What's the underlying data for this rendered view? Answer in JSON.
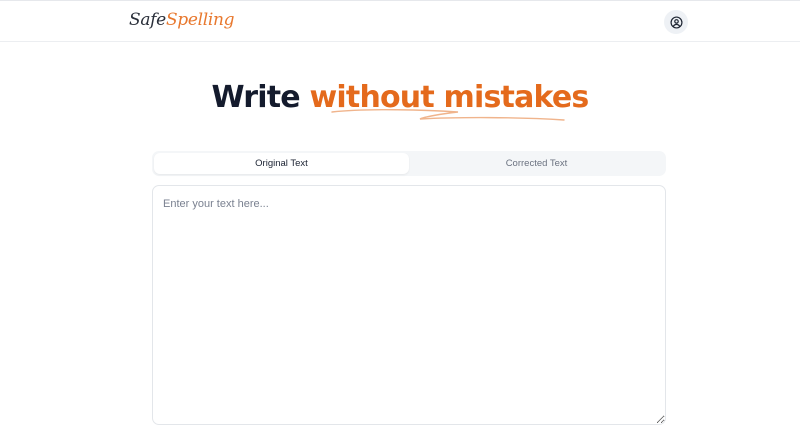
{
  "header": {
    "logo_part1": "Safe",
    "logo_part2": "Spelling",
    "account_icon": "user-circle-icon"
  },
  "hero": {
    "title_plain": "Write ",
    "title_accent": "without mistakes"
  },
  "tabs": [
    {
      "label": "Original Text",
      "active": true
    },
    {
      "label": "Corrected Text",
      "active": false
    }
  ],
  "editor": {
    "value": "",
    "placeholder": "Enter your text here..."
  },
  "colors": {
    "accent": "#e46a1c",
    "heading": "#141b2d",
    "tab_bg": "#f4f6f8"
  }
}
